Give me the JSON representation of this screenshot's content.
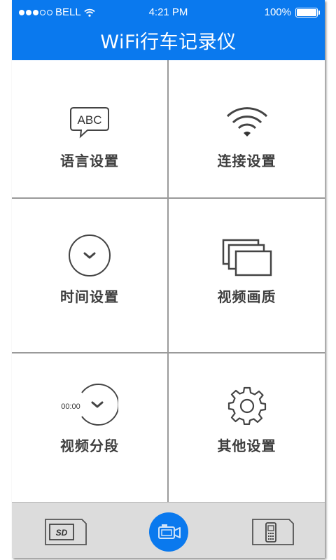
{
  "status_bar": {
    "carrier": "BELL",
    "time": "4:21 PM",
    "battery": "100%"
  },
  "header": {
    "title": "WiFi行车记录仪"
  },
  "menu": [
    {
      "label": "语言设置",
      "icon": "language-abc-icon",
      "icon_text": "ABC"
    },
    {
      "label": "连接设置",
      "icon": "wifi-icon"
    },
    {
      "label": "时间设置",
      "icon": "clock-chevron-icon"
    },
    {
      "label": "视频画质",
      "icon": "stacked-screens-icon"
    },
    {
      "label": "视频分段",
      "icon": "timer-segment-icon",
      "icon_text": "00:00"
    },
    {
      "label": "其他设置",
      "icon": "gear-icon"
    }
  ],
  "tab_bar": {
    "items": [
      {
        "icon": "sd-card-icon",
        "icon_text": "SD"
      },
      {
        "icon": "camera-icon"
      },
      {
        "icon": "phone-icon"
      }
    ],
    "active_color": "#0a79ee"
  },
  "colors": {
    "brand": "#0a79ee",
    "label": "#3e3e3e",
    "divider": "#9a9a9a"
  }
}
